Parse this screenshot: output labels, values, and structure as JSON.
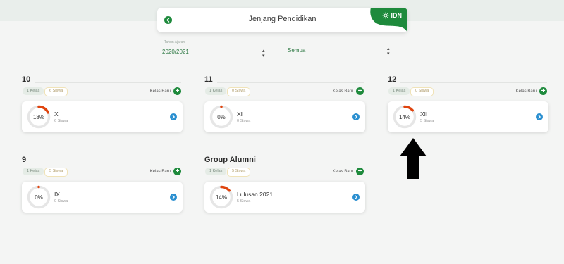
{
  "header": {
    "title": "Jenjang Pendidikan",
    "brand": "IDN",
    "brand_color": "#1e8a3c"
  },
  "filters": {
    "year_label": "Tahun Ajaran",
    "year_value": "2020/2021",
    "group_value": "Semua"
  },
  "sections": [
    {
      "title": "10",
      "kelas_chip": "1 Kelas",
      "siswa_chip": "6 Siswa",
      "new_label": "Kelas Baru",
      "card": {
        "percent_label": "18%",
        "percent": 18,
        "name": "X",
        "count": "6 Siswa"
      }
    },
    {
      "title": "11",
      "kelas_chip": "1 Kelas",
      "siswa_chip": "0 Siswa",
      "new_label": "Kelas Baru",
      "card": {
        "percent_label": "0%",
        "percent": 0,
        "name": "XI",
        "count": "0 Siswa"
      }
    },
    {
      "title": "12",
      "kelas_chip": "1 Kelas",
      "siswa_chip": "0 Siswa",
      "new_label": "Kelas Baru",
      "card": {
        "percent_label": "14%",
        "percent": 14,
        "name": "XII",
        "count": "5 Siswa"
      }
    },
    {
      "title": "9",
      "kelas_chip": "1 Kelas",
      "siswa_chip": "5 Siswa",
      "new_label": "Kelas Baru",
      "card": {
        "percent_label": "0%",
        "percent": 0,
        "name": "IX",
        "count": "0 Siswa"
      }
    },
    {
      "title": "Group Alumni",
      "kelas_chip": "1 Kelas",
      "siswa_chip": "5 Siswa",
      "new_label": "Kelas Baru",
      "card": {
        "percent_label": "14%",
        "percent": 14,
        "name": "Lulusan 2021",
        "count": "5 Siswa"
      }
    }
  ],
  "colors": {
    "accent": "#1e8a3c",
    "progress": "#e0440e",
    "ring_track": "#e6e6e6",
    "go_button": "#2a8fd0"
  }
}
